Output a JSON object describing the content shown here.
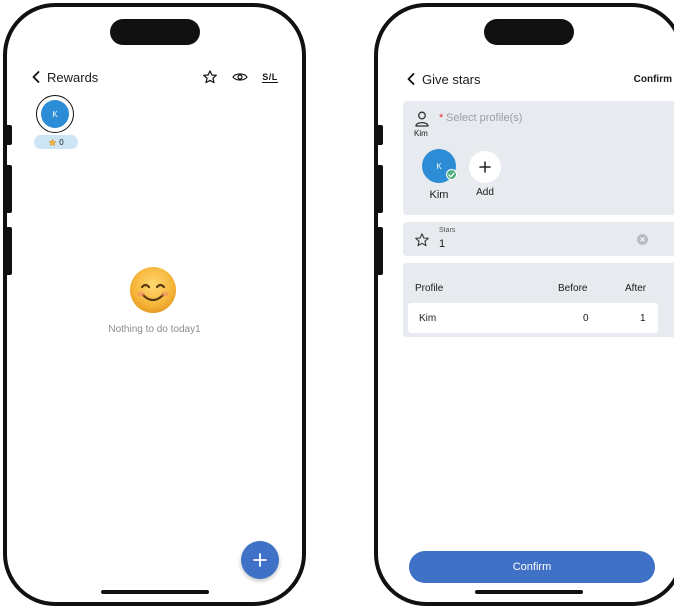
{
  "rewards_screen": {
    "title": "Rewards",
    "header_icons": [
      "star-outline-icon",
      "eye-icon",
      "sort-sl-icon"
    ],
    "sl_label": "S/L",
    "profile_avatar_initial": "K",
    "star_count": "0",
    "empty_emoji": "smiling-face-emoji",
    "empty_message": "Nothing to do today1",
    "fab_icon": "plus-icon"
  },
  "give_stars_screen": {
    "title": "Give stars",
    "header_confirm": "Confirm",
    "select_profiles": {
      "required_mark": "*",
      "placeholder": "Select profile(s)",
      "current_user": "Kim"
    },
    "selected_profiles": [
      {
        "initial": "K",
        "name": "Kim",
        "selected": true
      }
    ],
    "add_label": "Add",
    "stars_field": {
      "label": "Stars",
      "value": "1"
    },
    "table": {
      "headers": [
        "Profile",
        "Before",
        "After"
      ],
      "rows": [
        {
          "profile": "Kim",
          "before": "0",
          "after": "1"
        }
      ]
    },
    "confirm_button": "Confirm"
  },
  "colors": {
    "primary": "#3f71c6",
    "avatar": "#2c8dd6",
    "card_bg": "#e7eaee",
    "pill_bg": "#cde4f5",
    "required": "#e0393e",
    "check": "#4caf7d",
    "star_gold": "#f2b33d"
  }
}
